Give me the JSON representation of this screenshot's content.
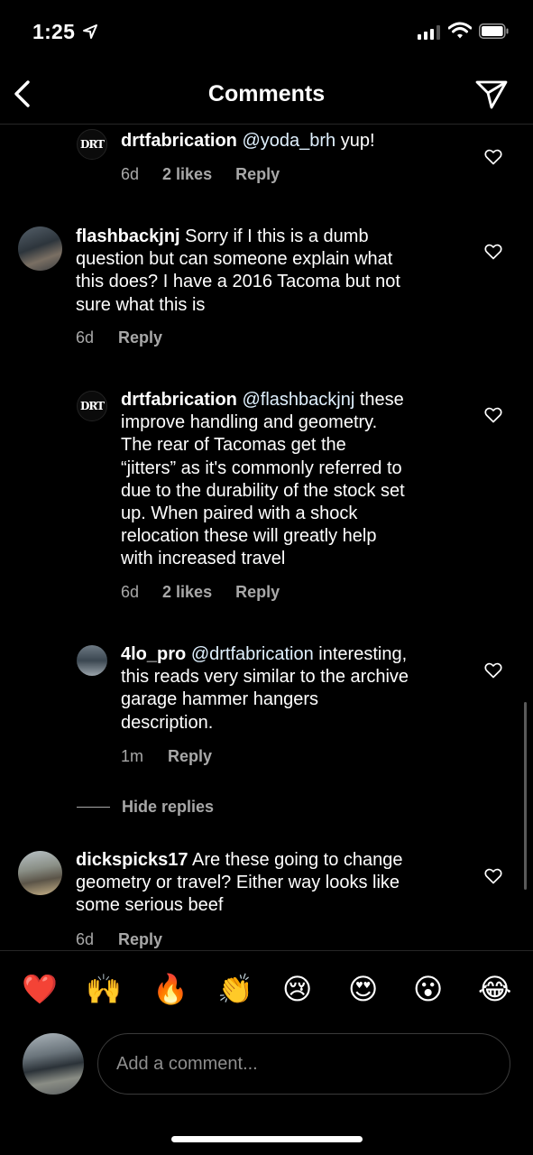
{
  "status_bar": {
    "time": "1:25"
  },
  "nav": {
    "title": "Comments"
  },
  "comments": [
    {
      "username": "drtfabrication",
      "mention": "@yoda_brh",
      "text": " yup!",
      "age": "6d",
      "likes": "2 likes",
      "reply_label": "Reply",
      "avatar": "drt-logo"
    },
    {
      "username": "flashbackjnj",
      "text_line1": " Sorry if I this is a dumb",
      "text_line2": "question but can someone explain what",
      "text_line3": "this does?  I have a 2016 Tacoma but not",
      "text_line4": "sure what this is",
      "age": "6d",
      "reply_label": "Reply"
    },
    {
      "username": "drtfabrication",
      "mention": "@flashbackjnj",
      "text_line1": " these",
      "text_line2": "improve handling and geometry.",
      "text_line3": "The rear of Tacomas get the",
      "text_line4": "“jitters” as it's commonly referred to",
      "text_line5": "due to the durability of the stock set",
      "text_line6": "up.  When paired with a shock",
      "text_line7": "relocation these will greatly help",
      "text_line8": "with increased travel",
      "age": "6d",
      "likes": "2 likes",
      "reply_label": "Reply"
    },
    {
      "username": "4lo_pro",
      "mention": "@drtfabrication",
      "text_line1": " interesting,",
      "text_line2": "this reads very similar to the archive",
      "text_line3": "garage hammer hangers",
      "text_line4": "description.",
      "age": "1m",
      "reply_label": "Reply"
    },
    {
      "username": "dickspicks17",
      "text_line1": " Are these going to change",
      "text_line2": "geometry or travel? Either way looks like",
      "text_line3": "some serious beef",
      "age": "6d",
      "reply_label": "Reply"
    }
  ],
  "hide_replies_label": "Hide replies",
  "emoji_bar": [
    "❤️",
    "🙌",
    "🔥",
    "👏",
    "😢",
    "😍",
    "😮",
    "😂"
  ],
  "composer": {
    "placeholder": "Add a comment..."
  },
  "icons": {
    "back": "chevron-left-icon",
    "send": "paper-plane-icon",
    "heart": "heart-outline-icon"
  }
}
